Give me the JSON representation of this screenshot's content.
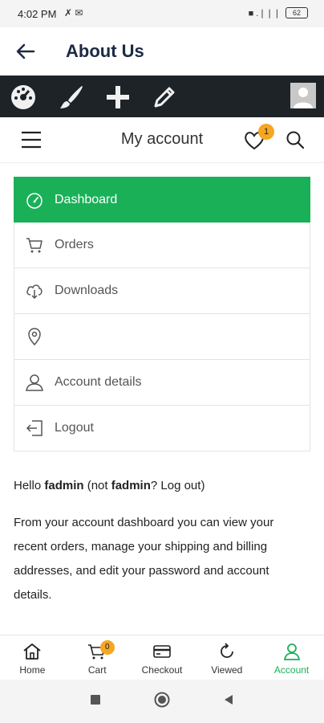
{
  "status_bar": {
    "time": "4:02 PM",
    "left_icons": "✗ ✉",
    "signal": "■ .❘❘❘",
    "battery": "62"
  },
  "app_bar": {
    "title": "About Us",
    "back_icon": "arrow-left-icon"
  },
  "admin_toolbar": {
    "icons": [
      "dashboard-gauge-icon",
      "brush-icon",
      "plus-icon",
      "pencil-icon",
      "user-avatar"
    ]
  },
  "site_header": {
    "title": "My account",
    "wishlist_count": "1"
  },
  "account_nav": {
    "items": [
      {
        "label": "Dashboard",
        "icon": "gauge-icon",
        "active": true
      },
      {
        "label": "Orders",
        "icon": "cart-icon"
      },
      {
        "label": "Downloads",
        "icon": "cloud-download-icon"
      },
      {
        "label": "",
        "icon": "map-pin-icon"
      },
      {
        "label": "Account details",
        "icon": "user-icon"
      },
      {
        "label": "Logout",
        "icon": "logout-icon"
      }
    ]
  },
  "content": {
    "hello_prefix": "Hello ",
    "username": "fadmin",
    "not_prefix": " (not ",
    "not_user": "fadmin",
    "log_out_link": "? Log out",
    "close_paren": ")",
    "desc_1": "From your account dashboard you can view your ",
    "recent_orders_link": "recent orders",
    "desc_2": ", manage your ",
    "addresses_link": "shipping and billing addresses",
    "desc_3": ", and ",
    "edit_link": "edit your password and account details",
    "desc_4": "."
  },
  "bottom_nav": {
    "items": [
      {
        "label": "Home",
        "icon": "home-icon"
      },
      {
        "label": "Cart",
        "icon": "cart-icon",
        "badge": "0"
      },
      {
        "label": "Checkout",
        "icon": "card-icon"
      },
      {
        "label": "Viewed",
        "icon": "refresh-icon"
      },
      {
        "label": "Account",
        "icon": "user-icon",
        "active": true
      }
    ]
  },
  "colors": {
    "accent": "#1ab058",
    "toolbar": "#1d2327",
    "badge": "#f5a623",
    "title": "#1c2a44"
  }
}
